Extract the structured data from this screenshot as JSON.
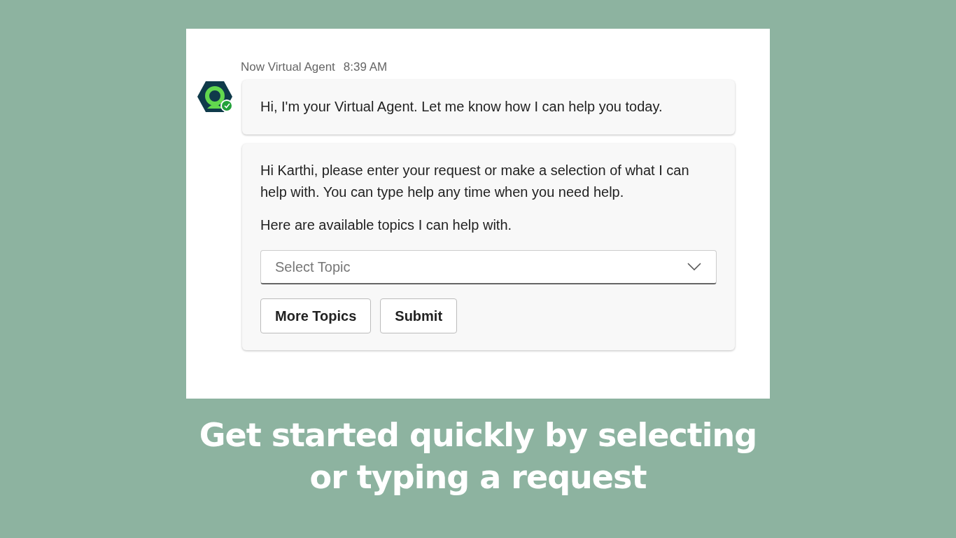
{
  "agent": {
    "name": "Now Virtual Agent",
    "time": "8:39 AM",
    "online": true
  },
  "messages": [
    {
      "kind": "text",
      "paragraphs": [
        "Hi, I'm your Virtual Agent. Let me know how I can help you today."
      ]
    },
    {
      "kind": "topics",
      "paragraphs": [
        "Hi Karthi, please enter your request or make a selection of what I can help with. You can type help any time when you need help.",
        "Here are available topics I can help with."
      ],
      "select": {
        "placeholder": "Select Topic"
      },
      "buttons": [
        "More Topics",
        "Submit"
      ]
    }
  ],
  "caption_lines": [
    "Get started quickly by selecting",
    "or typing a request"
  ]
}
